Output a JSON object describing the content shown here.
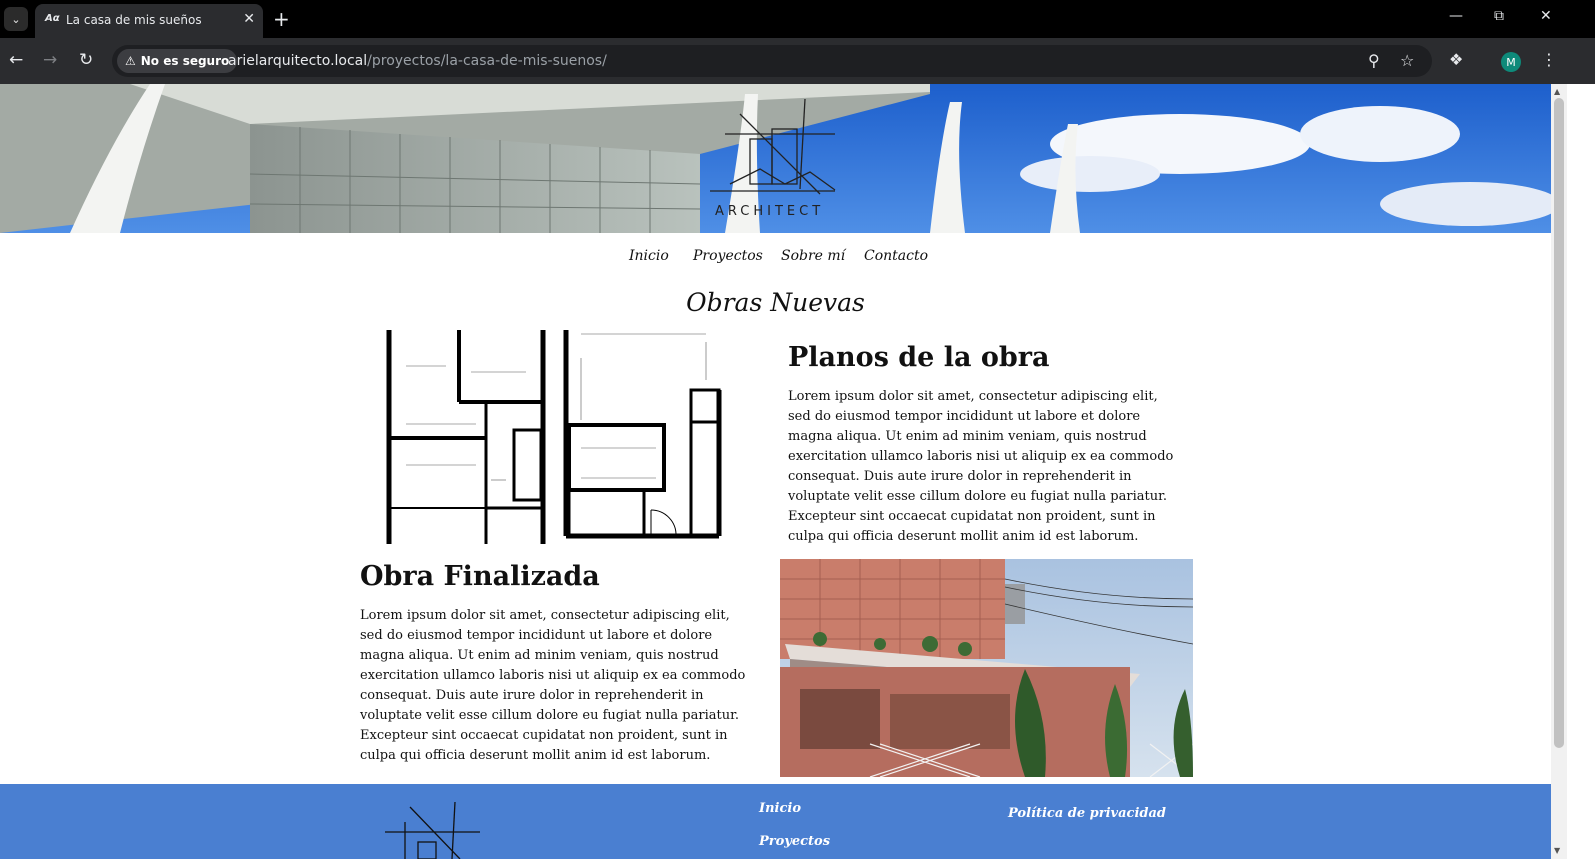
{
  "browser": {
    "tab_title": "La casa de mis sueños",
    "security_label": "No es seguro",
    "url_host": "arielarquitecto.local",
    "url_path": "/proyectos/la-casa-de-mis-suenos/",
    "profile_initial": "M"
  },
  "header": {
    "logo_text": "ARCHITECT"
  },
  "nav": {
    "items": [
      "Inicio",
      "Proyectos",
      "Sobre mí",
      "Contacto"
    ]
  },
  "main": {
    "section_title": "Obras Nuevas",
    "plans": {
      "heading": "Planos de la obra",
      "text": "Lorem ipsum dolor sit amet, consectetur adipiscing elit, sed do eiusmod tempor incididunt ut labore et dolore magna aliqua. Ut enim ad minim veniam, quis nostrud exercitation ullamco laboris nisi ut aliquip ex ea commodo consequat. Duis aute irure dolor in reprehenderit in voluptate velit esse cillum dolore eu fugiat nulla pariatur. Excepteur sint occaecat cupidatat non proident, sunt in culpa qui officia deserunt mollit anim id est laborum."
    },
    "finished": {
      "heading": "Obra Finalizada",
      "text": "Lorem ipsum dolor sit amet, consectetur adipiscing elit, sed do eiusmod tempor incididunt ut labore et dolore magna aliqua. Ut enim ad minim veniam, quis nostrud exercitation ullamco laboris nisi ut aliquip ex ea commodo consequat. Duis aute irure dolor in reprehenderit in voluptate velit esse cillum dolore eu fugiat nulla pariatur. Excepteur sint occaecat cupidatat non proident, sunt in culpa qui officia deserunt mollit anim id est laborum."
    }
  },
  "footer": {
    "links": [
      "Inicio",
      "Proyectos"
    ],
    "privacy": "Política de privacidad"
  },
  "colors": {
    "footer_bg": "#4a7fd1",
    "tab_bar": "#000000",
    "toolbar": "#2b2c2f"
  }
}
